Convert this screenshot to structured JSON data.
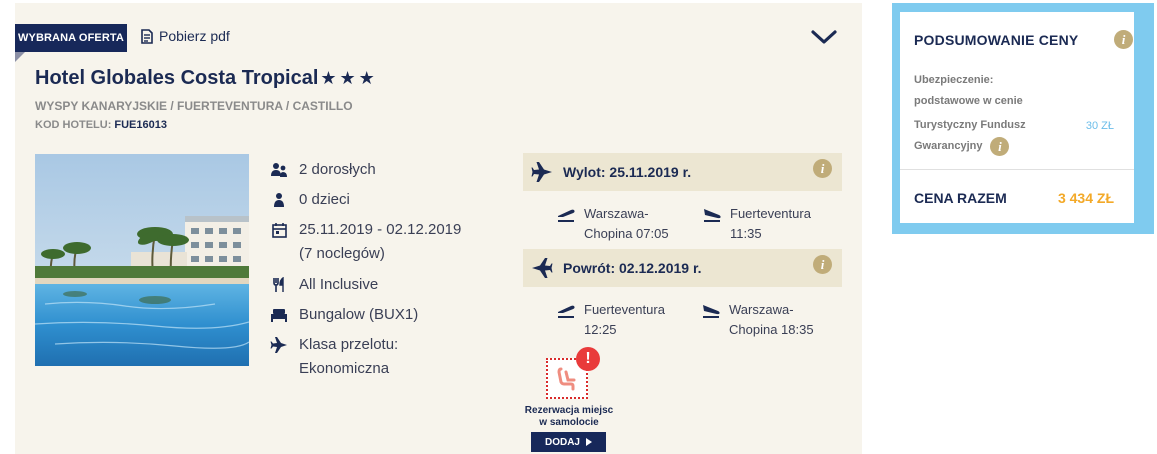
{
  "offer": {
    "badge": "WYBRANA OFERTA",
    "pdf_label": "Pobierz pdf",
    "hotel_name": "Hotel Globales Costa Tropical",
    "stars": "★★★",
    "location": "WYSPY KANARYJSKIE / FUERTEVENTURA / CASTILLO",
    "hotel_code_label": "KOD HOTELU:",
    "hotel_code": "FUE16013",
    "facts": {
      "adults": "2 dorosłych",
      "children": "0 dzieci",
      "dates": "25.11.2019 - 02.12.2019",
      "nights": "(7 noclegów)",
      "board": "All Inclusive",
      "room": "Bungalow (BUX1)",
      "flight_class_label": "Klasa przelotu:",
      "flight_class": "Ekonomiczna"
    },
    "outbound": {
      "title": "Wylot: 25.11.2019 r.",
      "departure_line1": "Warszawa-",
      "departure_line2": "Chopina 07:05",
      "arrival_line1": "Fuerteventura",
      "arrival_line2": "11:35"
    },
    "return": {
      "title": "Powrót: 02.12.2019 r.",
      "departure_line1": "Fuerteventura",
      "departure_line2": "12:25",
      "arrival_line1": "Warszawa-",
      "arrival_line2": "Chopina 18:35"
    },
    "seat": {
      "line1": "Rezerwacja miejsc",
      "line2": "w samolocie",
      "alert": "!",
      "add_label": "DODAJ"
    }
  },
  "summary": {
    "title": "PODSUMOWANIE CENY",
    "insurance_label_1": "Ubezpieczenie:",
    "insurance_label_2": "podstawowe w cenie",
    "fund_label_1": "Turystyczny Fundusz",
    "fund_label_2": "Gwarancyjny",
    "fund_value": "30 ZŁ",
    "total_label": "CENA RAZEM",
    "total_value": "3 434 ZŁ"
  },
  "info_glyph": "i",
  "colors": {
    "navy": "#17285a",
    "beige_bg": "#f7f4ec",
    "flight_header_bg": "#ece6d2",
    "info_gold": "#c0ac79",
    "summary_frame": "#7fcbef",
    "total_orange": "#f3a928",
    "alert_red": "#e93b3b"
  },
  "icons": [
    "pdf-icon",
    "chevron-down-icon",
    "adults-icon",
    "child-icon",
    "calendar-icon",
    "cutlery-icon",
    "bed-icon",
    "plane-icon",
    "takeoff-icon",
    "landing-icon",
    "info-icon",
    "seat-icon",
    "play-icon"
  ]
}
